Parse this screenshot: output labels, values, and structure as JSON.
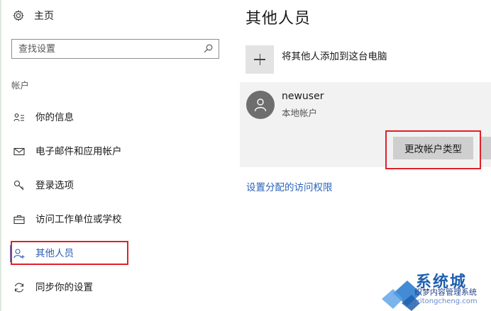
{
  "sidebar": {
    "home_label": "主页",
    "search_placeholder": "查找设置",
    "section_label": "帐户",
    "items": [
      {
        "label": "你的信息",
        "icon": "user-info-icon"
      },
      {
        "label": "电子邮件和应用帐户",
        "icon": "mail-icon"
      },
      {
        "label": "登录选项",
        "icon": "key-icon"
      },
      {
        "label": "访问工作单位或学校",
        "icon": "briefcase-icon"
      },
      {
        "label": "其他人员",
        "icon": "add-person-icon",
        "active": true
      },
      {
        "label": "同步你的设置",
        "icon": "sync-icon"
      }
    ]
  },
  "main": {
    "title": "其他人员",
    "add_label": "将其他人添加到这台电脑",
    "account": {
      "name": "newuser",
      "type": "本地帐户",
      "change_button": "更改帐户类型"
    },
    "access_link": "设置分配的访问权限"
  },
  "watermark": {
    "brand": "系统城",
    "sub": "织梦内容管理系统",
    "url": "xitongcheng.com"
  },
  "colors": {
    "accent": "#2b5db0",
    "highlight": "#e0202a",
    "link": "#2b62b8"
  }
}
